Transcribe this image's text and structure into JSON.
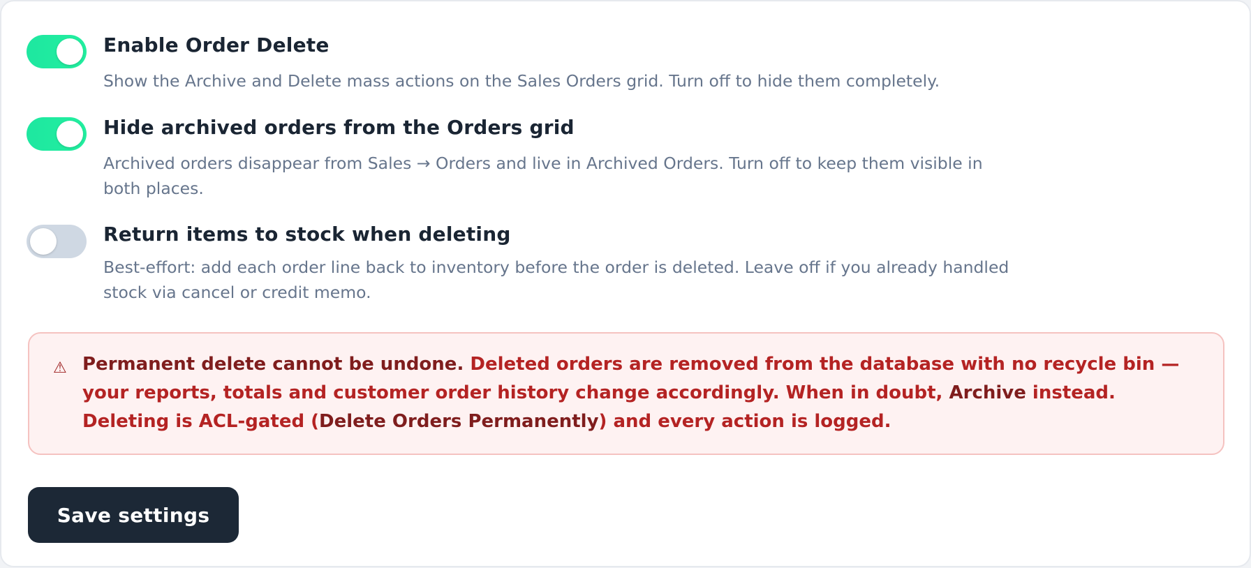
{
  "settings": [
    {
      "title": "Enable Order Delete",
      "description": "Show the Archive and Delete mass actions on the Sales Orders grid. Turn off to hide them completely.",
      "enabled": true
    },
    {
      "title": "Hide archived orders from the Orders grid",
      "description": "Archived orders disappear from Sales → Orders and live in Archived Orders. Turn off to keep them visible in both places.",
      "enabled": true
    },
    {
      "title": "Return items to stock when deleting",
      "description": "Best-effort: add each order line back to inventory before the order is deleted. Leave off if you already handled stock via cancel or credit memo.",
      "enabled": false
    }
  ],
  "warning": {
    "icon": "warning-triangle-icon",
    "icon_glyph": "⚠",
    "lead": "Permanent delete cannot be undone.",
    "body_1": " Deleted orders are removed from the database with no recycle bin — your reports, totals and customer order history change accordingly. When in doubt, ",
    "archive": "Archive",
    "body_2": " instead. Deleting is ACL-gated (",
    "acl": "Delete Orders Permanently",
    "body_3": ") and every action is logged."
  },
  "actions": {
    "save_label": "Save settings"
  },
  "colors": {
    "toggle_on": "#20e6a3",
    "toggle_off": "#cfd8e3",
    "warning_bg": "#fef2f2",
    "warning_border": "#f5c2c0",
    "warning_text": "#b42323",
    "button_bg": "#1c2836"
  }
}
